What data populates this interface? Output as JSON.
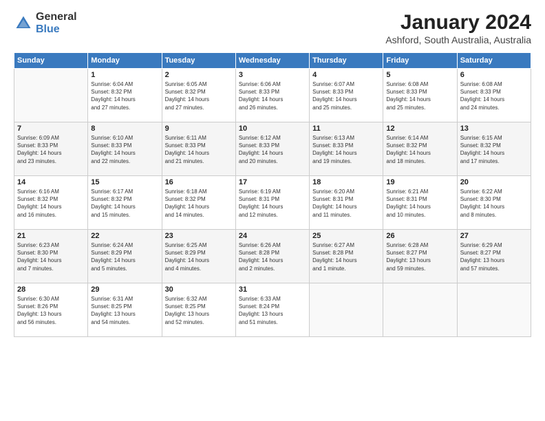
{
  "header": {
    "logo_general": "General",
    "logo_blue": "Blue",
    "title": "January 2024",
    "location": "Ashford, South Australia, Australia"
  },
  "days_of_week": [
    "Sunday",
    "Monday",
    "Tuesday",
    "Wednesday",
    "Thursday",
    "Friday",
    "Saturday"
  ],
  "weeks": [
    [
      {
        "day": "",
        "info": ""
      },
      {
        "day": "1",
        "info": "Sunrise: 6:04 AM\nSunset: 8:32 PM\nDaylight: 14 hours\nand 27 minutes."
      },
      {
        "day": "2",
        "info": "Sunrise: 6:05 AM\nSunset: 8:32 PM\nDaylight: 14 hours\nand 27 minutes."
      },
      {
        "day": "3",
        "info": "Sunrise: 6:06 AM\nSunset: 8:33 PM\nDaylight: 14 hours\nand 26 minutes."
      },
      {
        "day": "4",
        "info": "Sunrise: 6:07 AM\nSunset: 8:33 PM\nDaylight: 14 hours\nand 25 minutes."
      },
      {
        "day": "5",
        "info": "Sunrise: 6:08 AM\nSunset: 8:33 PM\nDaylight: 14 hours\nand 25 minutes."
      },
      {
        "day": "6",
        "info": "Sunrise: 6:08 AM\nSunset: 8:33 PM\nDaylight: 14 hours\nand 24 minutes."
      }
    ],
    [
      {
        "day": "7",
        "info": "Sunrise: 6:09 AM\nSunset: 8:33 PM\nDaylight: 14 hours\nand 23 minutes."
      },
      {
        "day": "8",
        "info": "Sunrise: 6:10 AM\nSunset: 8:33 PM\nDaylight: 14 hours\nand 22 minutes."
      },
      {
        "day": "9",
        "info": "Sunrise: 6:11 AM\nSunset: 8:33 PM\nDaylight: 14 hours\nand 21 minutes."
      },
      {
        "day": "10",
        "info": "Sunrise: 6:12 AM\nSunset: 8:33 PM\nDaylight: 14 hours\nand 20 minutes."
      },
      {
        "day": "11",
        "info": "Sunrise: 6:13 AM\nSunset: 8:33 PM\nDaylight: 14 hours\nand 19 minutes."
      },
      {
        "day": "12",
        "info": "Sunrise: 6:14 AM\nSunset: 8:32 PM\nDaylight: 14 hours\nand 18 minutes."
      },
      {
        "day": "13",
        "info": "Sunrise: 6:15 AM\nSunset: 8:32 PM\nDaylight: 14 hours\nand 17 minutes."
      }
    ],
    [
      {
        "day": "14",
        "info": "Sunrise: 6:16 AM\nSunset: 8:32 PM\nDaylight: 14 hours\nand 16 minutes."
      },
      {
        "day": "15",
        "info": "Sunrise: 6:17 AM\nSunset: 8:32 PM\nDaylight: 14 hours\nand 15 minutes."
      },
      {
        "day": "16",
        "info": "Sunrise: 6:18 AM\nSunset: 8:32 PM\nDaylight: 14 hours\nand 14 minutes."
      },
      {
        "day": "17",
        "info": "Sunrise: 6:19 AM\nSunset: 8:31 PM\nDaylight: 14 hours\nand 12 minutes."
      },
      {
        "day": "18",
        "info": "Sunrise: 6:20 AM\nSunset: 8:31 PM\nDaylight: 14 hours\nand 11 minutes."
      },
      {
        "day": "19",
        "info": "Sunrise: 6:21 AM\nSunset: 8:31 PM\nDaylight: 14 hours\nand 10 minutes."
      },
      {
        "day": "20",
        "info": "Sunrise: 6:22 AM\nSunset: 8:30 PM\nDaylight: 14 hours\nand 8 minutes."
      }
    ],
    [
      {
        "day": "21",
        "info": "Sunrise: 6:23 AM\nSunset: 8:30 PM\nDaylight: 14 hours\nand 7 minutes."
      },
      {
        "day": "22",
        "info": "Sunrise: 6:24 AM\nSunset: 8:29 PM\nDaylight: 14 hours\nand 5 minutes."
      },
      {
        "day": "23",
        "info": "Sunrise: 6:25 AM\nSunset: 8:29 PM\nDaylight: 14 hours\nand 4 minutes."
      },
      {
        "day": "24",
        "info": "Sunrise: 6:26 AM\nSunset: 8:28 PM\nDaylight: 14 hours\nand 2 minutes."
      },
      {
        "day": "25",
        "info": "Sunrise: 6:27 AM\nSunset: 8:28 PM\nDaylight: 14 hours\nand 1 minute."
      },
      {
        "day": "26",
        "info": "Sunrise: 6:28 AM\nSunset: 8:27 PM\nDaylight: 13 hours\nand 59 minutes."
      },
      {
        "day": "27",
        "info": "Sunrise: 6:29 AM\nSunset: 8:27 PM\nDaylight: 13 hours\nand 57 minutes."
      }
    ],
    [
      {
        "day": "28",
        "info": "Sunrise: 6:30 AM\nSunset: 8:26 PM\nDaylight: 13 hours\nand 56 minutes."
      },
      {
        "day": "29",
        "info": "Sunrise: 6:31 AM\nSunset: 8:25 PM\nDaylight: 13 hours\nand 54 minutes."
      },
      {
        "day": "30",
        "info": "Sunrise: 6:32 AM\nSunset: 8:25 PM\nDaylight: 13 hours\nand 52 minutes."
      },
      {
        "day": "31",
        "info": "Sunrise: 6:33 AM\nSunset: 8:24 PM\nDaylight: 13 hours\nand 51 minutes."
      },
      {
        "day": "",
        "info": ""
      },
      {
        "day": "",
        "info": ""
      },
      {
        "day": "",
        "info": ""
      }
    ]
  ]
}
